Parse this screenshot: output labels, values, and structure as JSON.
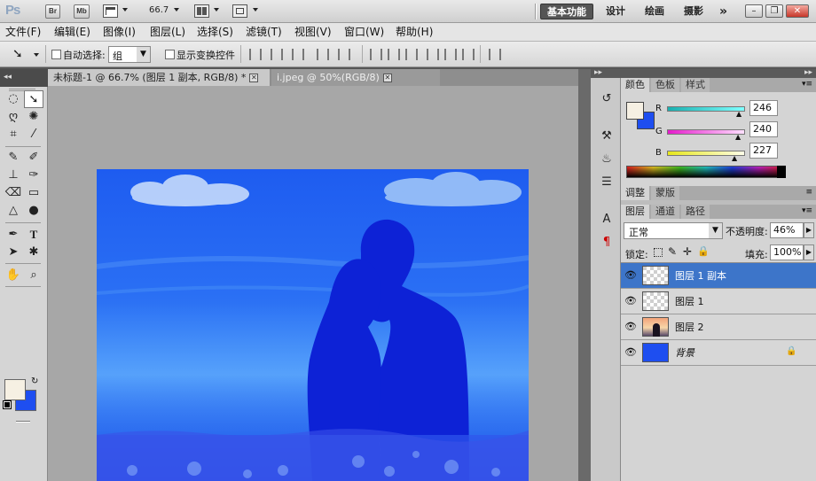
{
  "appbar": {
    "logo": "Ps",
    "bridge_label": "Br",
    "minibridge_label": "Mb",
    "zoom": "66.7",
    "workspaces": [
      "基本功能",
      "设计",
      "绘画",
      "摄影"
    ],
    "more": "»"
  },
  "menubar": {
    "items": [
      "文件(F)",
      "编辑(E)",
      "图像(I)",
      "图层(L)",
      "选择(S)",
      "滤镜(T)",
      "视图(V)",
      "窗口(W)",
      "帮助(H)"
    ]
  },
  "options": {
    "auto_select_label": "自动选择:",
    "auto_select_value": "组",
    "show_transform_label": "显示变换控件"
  },
  "tabs": [
    {
      "label": "未标题-1 @ 66.7% (图层 1 副本, RGB/8) *",
      "active": true
    },
    {
      "label": "i.jpeg @ 50%(RGB/8)",
      "active": false
    }
  ],
  "color_panel": {
    "tabs": [
      "颜色",
      "色板",
      "样式"
    ],
    "channels": [
      {
        "name": "R",
        "value": "246"
      },
      {
        "name": "G",
        "value": "240"
      },
      {
        "name": "B",
        "value": "227"
      }
    ],
    "foreground": "#f6f0e3",
    "background": "#1e4ef0"
  },
  "adjust_panel": {
    "tabs": [
      "调整",
      "蒙版"
    ]
  },
  "layers_panel": {
    "tabs": [
      "图层",
      "通道",
      "路径"
    ],
    "blend_mode": "正常",
    "opacity_label": "不透明度:",
    "opacity": "46%",
    "lock_label": "锁定:",
    "fill_label": "填充:",
    "fill": "100%",
    "layers": [
      {
        "name": "图层 1 副本",
        "selected": true,
        "thumb": "transparent"
      },
      {
        "name": "图层 1",
        "selected": false,
        "thumb": "transparent"
      },
      {
        "name": "图层 2",
        "selected": false,
        "thumb": "photo"
      },
      {
        "name": "背景",
        "selected": false,
        "thumb": "blue",
        "locked": true
      }
    ]
  },
  "colors": {
    "accent_selected": "#3d75c9",
    "canvas_blue": "#2a6ff4",
    "silhouette": "#0d22d6"
  }
}
